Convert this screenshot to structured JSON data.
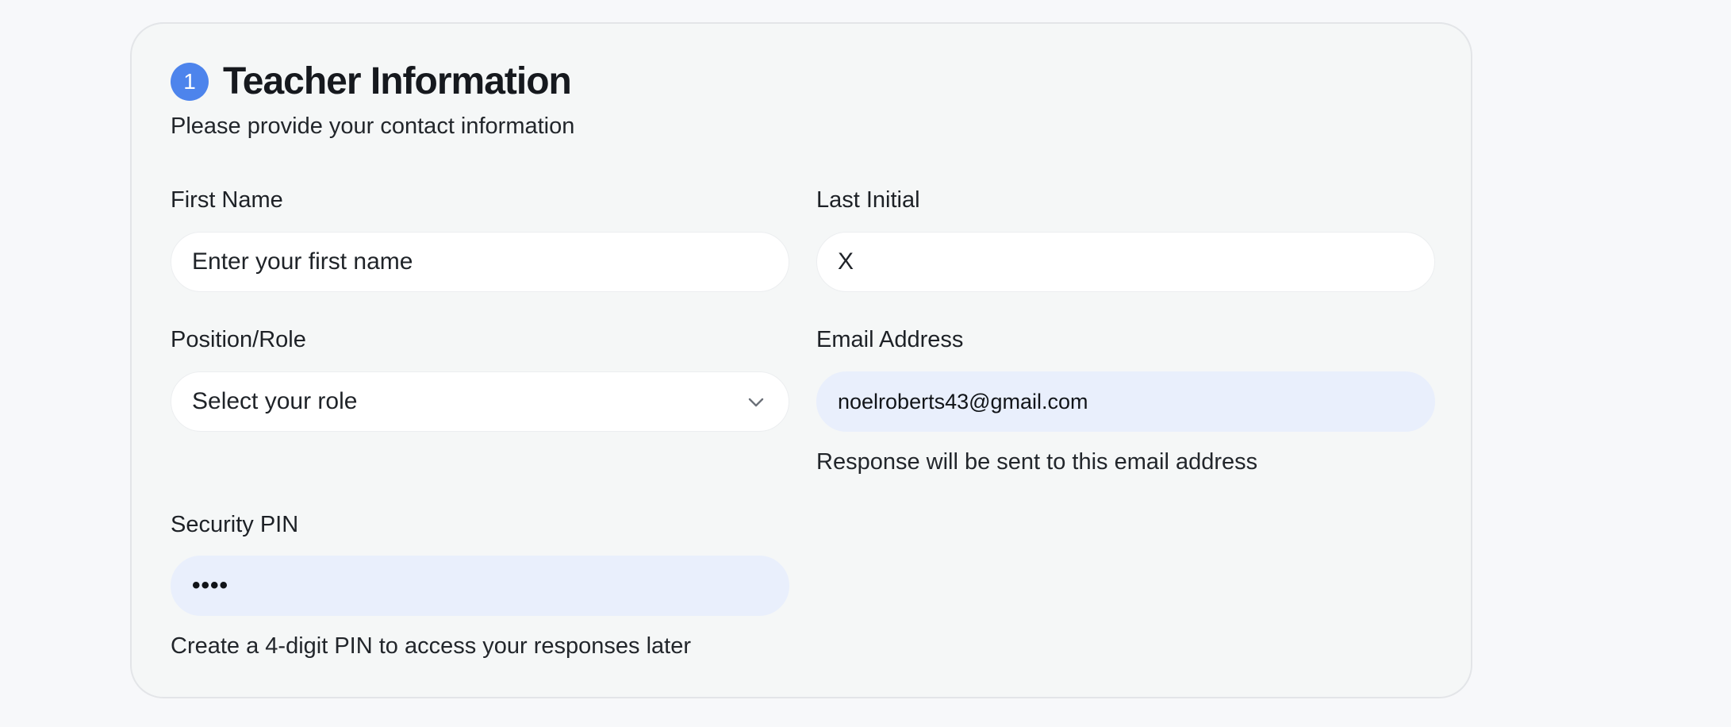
{
  "section": {
    "step_number": "1",
    "title": "Teacher Information",
    "subtitle": "Please provide your contact information"
  },
  "fields": {
    "first_name": {
      "label": "First Name",
      "value": "",
      "placeholder": "Enter your first name"
    },
    "last_initial": {
      "label": "Last Initial",
      "value": "X"
    },
    "position_role": {
      "label": "Position/Role",
      "selected": "Select your role",
      "icon": "chevron-down-icon"
    },
    "email": {
      "label": "Email Address",
      "value": "noelroberts43@gmail.com",
      "help": "Response will be sent to this email address"
    },
    "security_pin": {
      "label": "Security PIN",
      "value_masked": "••••",
      "help": "Create a 4-digit PIN to access your responses later"
    }
  },
  "colors": {
    "accent": "#4d84ec",
    "autofill_background": "#e9effc",
    "card_background": "#f5f7f7",
    "page_background": "#f7f8fa"
  }
}
